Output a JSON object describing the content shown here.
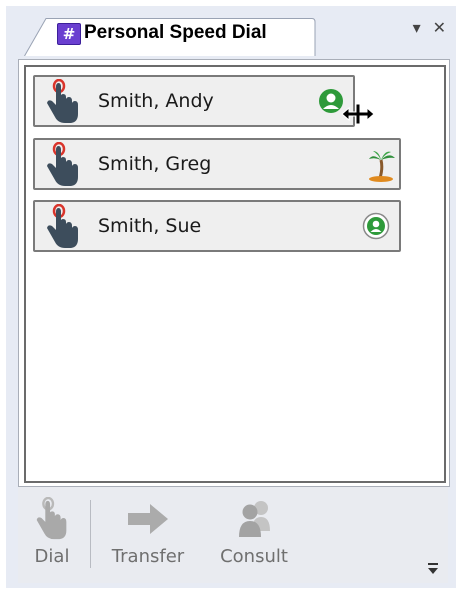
{
  "panel": {
    "title": "Personal Speed Dial",
    "tab_icon_glyph": "#",
    "dropdown_glyph": "▾",
    "close_glyph": "✕"
  },
  "contacts": [
    {
      "name": "Smith, Andy",
      "status_icon": "presence-available-icon",
      "status_color": "#2e9a3a"
    },
    {
      "name": "Smith, Greg",
      "status_icon": "vacation-palm-icon",
      "status_color": "#e08a1e"
    },
    {
      "name": "Smith, Sue",
      "status_icon": "presence-available-outline-icon",
      "status_color": "#2e9a3a"
    }
  ],
  "toolbar": {
    "dial_label": "Dial",
    "transfer_label": "Transfer",
    "consult_label": "Consult"
  },
  "colors": {
    "frame": "#e7ebf4",
    "tab_icon": "#6a3fd0",
    "hand": "#3d4d5c",
    "hand_tip": "#d9342b",
    "disabled": "#a9a9a9"
  }
}
